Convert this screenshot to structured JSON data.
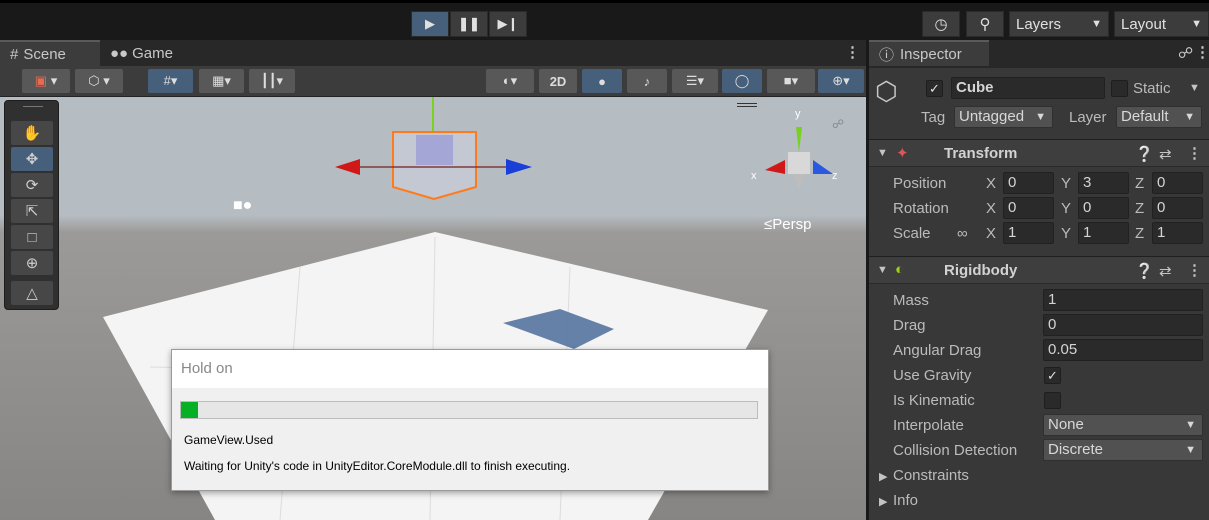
{
  "toolbar": {
    "play_icon": "play-icon",
    "pause_icon": "pause-icon",
    "step_icon": "step-icon",
    "history_icon": "history-icon",
    "search_icon": "search-icon",
    "layers_label": "Layers",
    "layout_label": "Layout"
  },
  "tabs": {
    "scene": "Scene",
    "game": "Game",
    "inspector": "Inspector"
  },
  "scene_toolbar": {
    "label_2d": "2D"
  },
  "viewport": {
    "persp_label": "≤Persp",
    "gizmo_x": "x",
    "gizmo_y": "y",
    "gizmo_z": "z"
  },
  "dialog": {
    "title": "Hold on",
    "progress": 0.03,
    "line1": "GameView.Used",
    "line2": "Waiting for Unity's code in UnityEditor.CoreModule.dll to finish executing."
  },
  "inspector": {
    "object_active": "✓",
    "object_name": "Cube",
    "static_label": "Static",
    "tag_label": "Tag",
    "tag_value": "Untagged",
    "layer_label": "Layer",
    "layer_value": "Default",
    "transform": {
      "title": "Transform",
      "position_label": "Position",
      "rotation_label": "Rotation",
      "scale_label": "Scale",
      "x": "X",
      "y": "Y",
      "z": "Z",
      "position": [
        "0",
        "3",
        "0"
      ],
      "rotation": [
        "0",
        "0",
        "0"
      ],
      "scale": [
        "1",
        "1",
        "1"
      ]
    },
    "rigidbody": {
      "title": "Rigidbody",
      "mass_label": "Mass",
      "mass": "1",
      "drag_label": "Drag",
      "drag": "0",
      "angular_drag_label": "Angular Drag",
      "angular_drag": "0.05",
      "use_gravity_label": "Use Gravity",
      "use_gravity": "✓",
      "is_kinematic_label": "Is Kinematic",
      "interpolate_label": "Interpolate",
      "interpolate": "None",
      "collision_label": "Collision Detection",
      "collision": "Discrete",
      "constraints_label": "Constraints",
      "info_label": "Info"
    }
  },
  "colors": {
    "accent_blue": "#46607c",
    "progress_green": "#06b025"
  }
}
